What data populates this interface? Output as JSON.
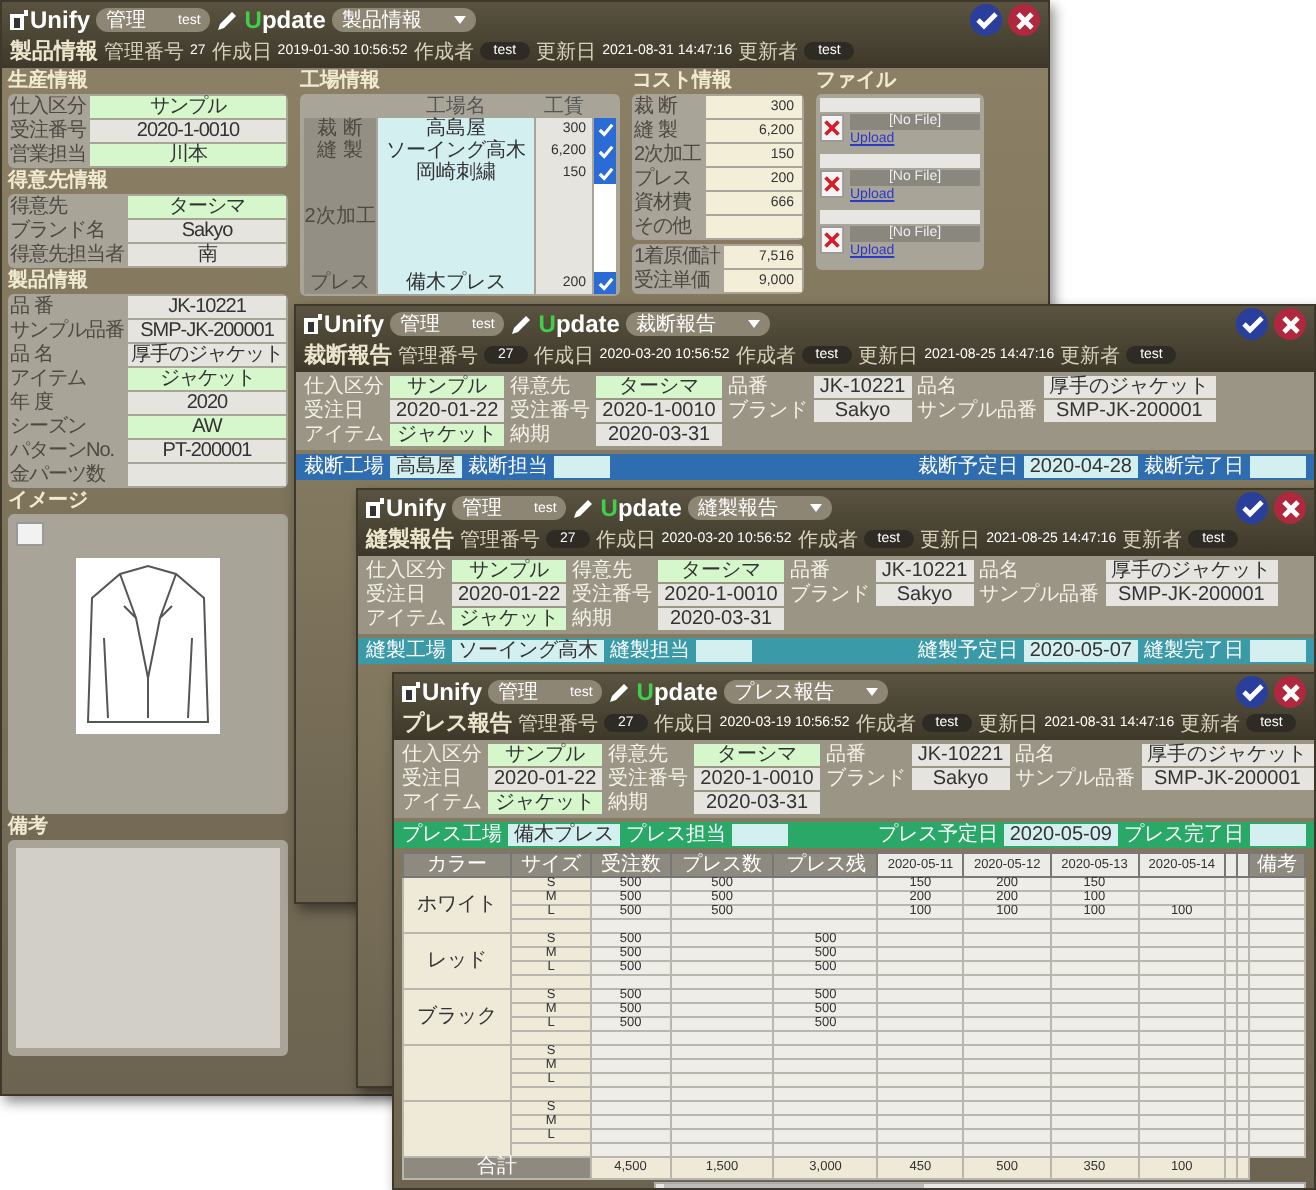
{
  "main": {
    "header": {
      "app": "Unify",
      "user_menu": "管理",
      "user": "test",
      "update": "Update",
      "screen_menu": "製品情報",
      "title": "製品情報",
      "meta": [
        {
          "label": "管理番号",
          "value": "27",
          "kind": "text"
        },
        {
          "label": "作成日",
          "value": "2019-01-30 10:56:52",
          "kind": "text"
        },
        {
          "label": "作成者",
          "value": "test",
          "kind": "pill"
        },
        {
          "label": "更新日",
          "value": "2021-08-31 14:47:16",
          "kind": "text"
        },
        {
          "label": "更新者",
          "value": "test",
          "kind": "pill"
        }
      ]
    },
    "production": {
      "title": "生産情報",
      "fields": [
        {
          "label": "仕入区分",
          "value": "サンプル",
          "kind": "lookup"
        },
        {
          "label": "受注番号",
          "value": "2020-1-0010",
          "kind": "text"
        },
        {
          "label": "営業担当",
          "value": "川本",
          "kind": "lookup"
        }
      ]
    },
    "customer": {
      "title": "得意先情報",
      "fields": [
        {
          "label": "得意先",
          "value": "ターシマ",
          "kind": "lookup"
        },
        {
          "label": "ブランド名",
          "value": "Sakyo",
          "kind": "text"
        },
        {
          "label": "得意先担当者",
          "value": "南",
          "kind": "text"
        }
      ]
    },
    "product": {
      "title": "製品情報",
      "fields": [
        {
          "label": "品 番",
          "value": "JK-10221",
          "kind": "text"
        },
        {
          "label": "サンプル品番",
          "value": "SMP-JK-200001",
          "kind": "text"
        },
        {
          "label": "品 名",
          "value": "厚手のジャケット",
          "kind": "text"
        },
        {
          "label": "アイテム",
          "value": "ジャケット",
          "kind": "lookup"
        },
        {
          "label": "年 度",
          "value": "2020",
          "kind": "text"
        },
        {
          "label": "シーズン",
          "value": "AW",
          "kind": "lookup"
        },
        {
          "label": "パターンNo.",
          "value": "PT-200001",
          "kind": "text"
        },
        {
          "label": "金パーツ数",
          "kind": "text"
        }
      ]
    },
    "image": {
      "title": "イメージ"
    },
    "notes": {
      "title": "備考"
    },
    "factory": {
      "title": "工場情報",
      "columns": [
        "工場名",
        "工賃"
      ],
      "groups": [
        {
          "label": "裁 断",
          "rows": [
            {
              "name": "高島屋",
              "price": "300",
              "checked": true
            }
          ]
        },
        {
          "label": "縫 製",
          "rows": [
            {
              "name": "ソーイング高木",
              "price": "6,200",
              "checked": true
            }
          ]
        },
        {
          "label": "2次加工",
          "rows": [
            {
              "name": "岡崎刺繍",
              "price": "150",
              "checked": true
            },
            {
              "checked": false
            },
            {
              "checked": false
            },
            {
              "checked": false
            },
            {
              "checked": false
            }
          ]
        },
        {
          "label": "プレス",
          "rows": [
            {
              "name": "備木プレス",
              "price": "200",
              "checked": true
            }
          ]
        }
      ]
    },
    "cost": {
      "title": "コスト情報",
      "fields": [
        {
          "label": "裁 断",
          "value": "300"
        },
        {
          "label": "縫 製",
          "value": "6,200"
        },
        {
          "label": "2次加工",
          "value": "150"
        },
        {
          "label": "プレス",
          "value": "200"
        },
        {
          "label": "資材費",
          "value": "666"
        },
        {
          "label": "その他"
        }
      ],
      "totals": [
        {
          "label": "1着原価計",
          "value": "7,516"
        },
        {
          "label": "受注単価",
          "value": "9,000"
        }
      ]
    },
    "files": {
      "title": "ファイル",
      "items": [
        {
          "status": "[No File]",
          "link": "Upload"
        },
        {
          "status": "[No File]",
          "link": "Upload"
        },
        {
          "status": "[No File]",
          "link": "Upload"
        }
      ]
    }
  },
  "reports": [
    {
      "header": {
        "app": "Unify",
        "user_menu": "管理",
        "user": "test",
        "update": "Update",
        "screen_menu": "裁断報告",
        "title": "裁断報告",
        "meta": [
          {
            "label": "管理番号",
            "value": "27",
            "kind": "pill"
          },
          {
            "label": "作成日",
            "value": "2020-03-20 10:56:52",
            "kind": "text"
          },
          {
            "label": "作成者",
            "value": "test",
            "kind": "pill"
          },
          {
            "label": "更新日",
            "value": "2021-08-25 14:47:16",
            "kind": "text"
          },
          {
            "label": "更新者",
            "value": "test",
            "kind": "pill"
          }
        ]
      },
      "info": [
        {
          "label": "仕入区分",
          "value": "サンプル",
          "kind": "lookup"
        },
        {
          "label": "得意先",
          "value": "ターシマ",
          "kind": "lookup"
        },
        {
          "label": "品番",
          "value": "JK-10221",
          "kind": "text"
        },
        {
          "label": "品名",
          "value": "厚手のジャケット",
          "kind": "text"
        },
        {
          "label": "受注日",
          "value": "2020-01-22",
          "kind": "text"
        },
        {
          "label": "受注番号",
          "value": "2020-1-0010",
          "kind": "text"
        },
        {
          "label": "ブランド",
          "value": "Sakyo",
          "kind": "text"
        },
        {
          "label": "サンプル品番",
          "value": "SMP-JK-200001",
          "kind": "text"
        },
        {
          "label": "アイテム",
          "value": "ジャケット",
          "kind": "lookup"
        },
        {
          "label": "納期",
          "value": "2020-03-31",
          "kind": "text"
        }
      ],
      "bar": {
        "color": "#2e6db0",
        "left": [
          {
            "label": "裁断工場",
            "value": "高島屋"
          },
          {
            "label": "裁断担当"
          }
        ],
        "right": [
          {
            "label": "裁断予定日",
            "value": "2020-04-28"
          },
          {
            "label": "裁断完了日"
          }
        ]
      }
    },
    {
      "header": {
        "app": "Unify",
        "user_menu": "管理",
        "user": "test",
        "update": "Update",
        "screen_menu": "縫製報告",
        "title": "縫製報告",
        "meta": [
          {
            "label": "管理番号",
            "value": "27",
            "kind": "pill"
          },
          {
            "label": "作成日",
            "value": "2020-03-20 10:56:52",
            "kind": "text"
          },
          {
            "label": "作成者",
            "value": "test",
            "kind": "pill"
          },
          {
            "label": "更新日",
            "value": "2021-08-25 14:47:16",
            "kind": "text"
          },
          {
            "label": "更新者",
            "value": "test",
            "kind": "pill"
          }
        ]
      },
      "info": [
        {
          "label": "仕入区分",
          "value": "サンプル",
          "kind": "lookup"
        },
        {
          "label": "得意先",
          "value": "ターシマ",
          "kind": "lookup"
        },
        {
          "label": "品番",
          "value": "JK-10221",
          "kind": "text"
        },
        {
          "label": "品名",
          "value": "厚手のジャケット",
          "kind": "text"
        },
        {
          "label": "受注日",
          "value": "2020-01-22",
          "kind": "text"
        },
        {
          "label": "受注番号",
          "value": "2020-1-0010",
          "kind": "text"
        },
        {
          "label": "ブランド",
          "value": "Sakyo",
          "kind": "text"
        },
        {
          "label": "サンプル品番",
          "value": "SMP-JK-200001",
          "kind": "text"
        },
        {
          "label": "アイテム",
          "value": "ジャケット",
          "kind": "lookup"
        },
        {
          "label": "納期",
          "value": "2020-03-31",
          "kind": "text"
        }
      ],
      "bar": {
        "color": "#3a9aa8",
        "left": [
          {
            "label": "縫製工場",
            "value": "ソーイング高木"
          },
          {
            "label": "縫製担当"
          }
        ],
        "right": [
          {
            "label": "縫製予定日",
            "value": "2020-05-07"
          },
          {
            "label": "縫製完了日"
          }
        ]
      }
    },
    {
      "header": {
        "app": "Unify",
        "user_menu": "管理",
        "user": "test",
        "update": "Update",
        "screen_menu": "プレス報告",
        "title": "プレス報告",
        "meta": [
          {
            "label": "管理番号",
            "value": "27",
            "kind": "pill"
          },
          {
            "label": "作成日",
            "value": "2020-03-19 10:56:52",
            "kind": "text"
          },
          {
            "label": "作成者",
            "value": "test",
            "kind": "pill"
          },
          {
            "label": "更新日",
            "value": "2021-08-31 14:47:16",
            "kind": "text"
          },
          {
            "label": "更新者",
            "value": "test",
            "kind": "pill"
          }
        ]
      },
      "info": [
        {
          "label": "仕入区分",
          "value": "サンプル",
          "kind": "lookup"
        },
        {
          "label": "得意先",
          "value": "ターシマ",
          "kind": "lookup"
        },
        {
          "label": "品番",
          "value": "JK-10221",
          "kind": "text"
        },
        {
          "label": "品名",
          "value": "厚手のジャケット",
          "kind": "text"
        },
        {
          "label": "受注日",
          "value": "2020-01-22",
          "kind": "text"
        },
        {
          "label": "受注番号",
          "value": "2020-1-0010",
          "kind": "text"
        },
        {
          "label": "ブランド",
          "value": "Sakyo",
          "kind": "text"
        },
        {
          "label": "サンプル品番",
          "value": "SMP-JK-200001",
          "kind": "text"
        },
        {
          "label": "アイテム",
          "value": "ジャケット",
          "kind": "lookup"
        },
        {
          "label": "納期",
          "value": "2020-03-31",
          "kind": "text"
        }
      ],
      "bar": {
        "color": "#2aa868",
        "left": [
          {
            "label": "プレス工場",
            "value": "備木プレス"
          },
          {
            "label": "プレス担当"
          }
        ],
        "right": [
          {
            "label": "プレス予定日",
            "value": "2020-05-09"
          },
          {
            "label": "プレス完了日"
          }
        ]
      },
      "table": {
        "columns": [
          "カラー",
          "サイズ",
          "受注数",
          "プレス数",
          "プレス残"
        ],
        "dates": [
          "2020-05-11",
          "2020-05-12",
          "2020-05-13",
          "2020-05-14"
        ],
        "remarks": "備考",
        "groups": [
          {
            "color_name": "ホワイト",
            "rows": [
              {
                "size": "S",
                "ordered": "500",
                "done": "500",
                "values": [
                  "150",
                  "200",
                  "150"
                ]
              },
              {
                "size": "M",
                "ordered": "500",
                "done": "500",
                "values": [
                  "200",
                  "200",
                  "100"
                ]
              },
              {
                "size": "L",
                "ordered": "500",
                "done": "500",
                "values": [
                  "100",
                  "100",
                  "100",
                  "100"
                ]
              }
            ]
          },
          {
            "color_name": "レッド",
            "rows": [
              {
                "size": "S",
                "ordered": "500",
                "remaining": "500"
              },
              {
                "size": "M",
                "ordered": "500",
                "remaining": "500"
              },
              {
                "size": "L",
                "ordered": "500",
                "remaining": "500"
              }
            ]
          },
          {
            "color_name": "ブラック",
            "rows": [
              {
                "size": "S",
                "ordered": "500",
                "remaining": "500"
              },
              {
                "size": "M",
                "ordered": "500",
                "remaining": "500"
              },
              {
                "size": "L",
                "ordered": "500",
                "remaining": "500"
              }
            ]
          },
          {
            "rows": [
              {
                "size": "S"
              },
              {
                "size": "M"
              },
              {
                "size": "L"
              }
            ]
          },
          {
            "rows": [
              {
                "size": "S"
              },
              {
                "size": "M"
              },
              {
                "size": "L"
              }
            ]
          }
        ],
        "totals": {
          "label": "合計",
          "values": [
            "4,500",
            "1,500",
            "3,000",
            "450",
            "500",
            "350",
            "100"
          ]
        }
      }
    }
  ]
}
